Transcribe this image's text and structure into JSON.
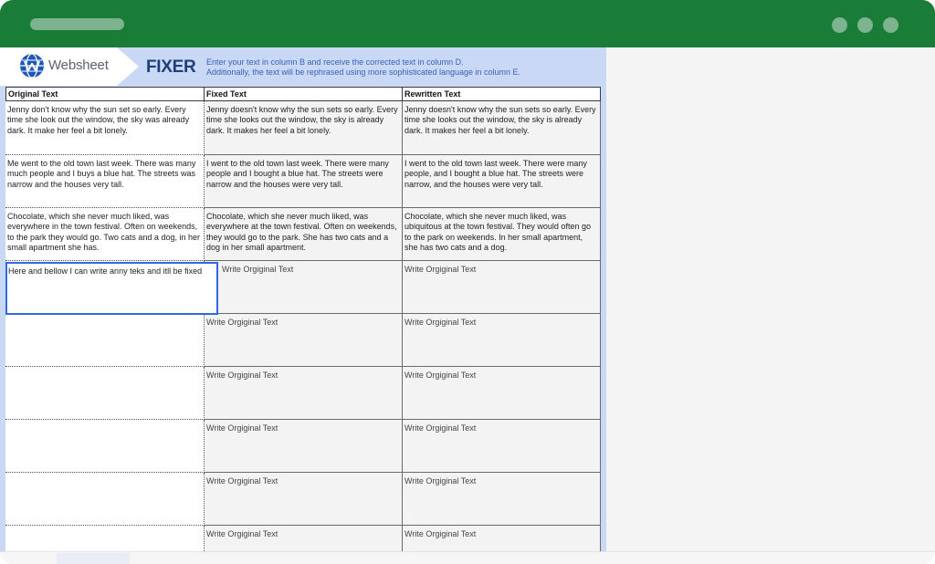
{
  "app": {
    "logo_text": "Websheet",
    "title": "FIXER"
  },
  "instructions": [
    "Enter your text in column B and receive the corrected text in column D.",
    "Additionally, the text will be rephrased using more sophisticated language in column E."
  ],
  "columns": {
    "original": "Original Text",
    "fixed": "Fixed Text",
    "rewritten": "Rewritten Text"
  },
  "rows": [
    {
      "original": "Jenny don't know why the sun set so early. Every time she look out the window, the sky was already dark. It make her feel a bit lonely.",
      "fixed": "Jenny doesn't know why the sun sets so early. Every time she looks out the window, the sky is already dark. It makes her feel a bit lonely.",
      "rewritten": "Jenny doesn't know why the sun sets so early. Every time she looks out the window, the sky is already dark. It makes her feel a bit lonely."
    },
    {
      "original": "Me went to the old town last week. There was many much people and I buys a blue hat. The streets was narrow and the houses very tall.",
      "fixed": "I went to the old town last week. There were many people and I bought a blue hat. The streets were narrow and the houses were very tall.",
      "rewritten": "I went to the old town last week. There were many people, and I bought a blue hat. The streets were narrow, and the houses were very tall."
    },
    {
      "original": "Chocolate, which she never much liked, was everywhere in the town festival. Often on weekends, to the park they would go. Two cats and a dog, in her small apartment she has.",
      "fixed": "Chocolate, which she never much liked, was everywhere at the town festival. Often on weekends, they would go to the park. She has two cats and a dog in her small apartment.",
      "rewritten": "Chocolate, which she never much liked, was ubiquitous at the town festival. They would often go to the park on weekends. In her small apartment, she has two cats and a dog."
    },
    {
      "original": "Here and bellow I can write anny teks and itll be fixed",
      "fixed": "Write Orgiginal Text",
      "rewritten": "Write Orgiginal Text"
    },
    {
      "original": "",
      "fixed": "Write Orgiginal Text",
      "rewritten": "Write Orgiginal Text"
    },
    {
      "original": "",
      "fixed": "Write Orgiginal Text",
      "rewritten": "Write Orgiginal Text"
    },
    {
      "original": "",
      "fixed": "Write Orgiginal Text",
      "rewritten": "Write Orgiginal Text"
    },
    {
      "original": "",
      "fixed": "Write Orgiginal Text",
      "rewritten": "Write Orgiginal Text"
    },
    {
      "original": "",
      "fixed": "Write Orgiginal Text",
      "rewritten": "Write Orgiginal Text"
    }
  ],
  "colors": {
    "titlebar": "#1a7d37",
    "accent": "#2d6cdf",
    "brand": "#1e3f7a",
    "banner": "#c9d8f5"
  },
  "icons": {
    "logo": "websheet-globe-icon",
    "window_controls": "circle-dot-icon"
  }
}
